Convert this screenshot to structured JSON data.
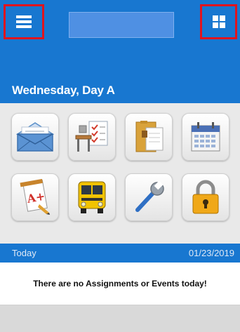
{
  "header": {
    "menu_icon": "hamburger-menu-icon",
    "apps_icon": "grid-apps-icon",
    "day": "Wednesday, Day A"
  },
  "tiles": [
    {
      "name": "mail-tile",
      "icon": "envelope-icon"
    },
    {
      "name": "classroom-tile",
      "icon": "classroom-desk-icon"
    },
    {
      "name": "folder-tile",
      "icon": "folder-documents-icon"
    },
    {
      "name": "calendar-tile",
      "icon": "calendar-icon"
    },
    {
      "name": "grades-tile",
      "icon": "report-card-icon"
    },
    {
      "name": "bus-tile",
      "icon": "school-bus-icon"
    },
    {
      "name": "tools-tile",
      "icon": "wrench-icon"
    },
    {
      "name": "lock-tile",
      "icon": "padlock-icon"
    }
  ],
  "today_bar": {
    "label": "Today",
    "date": "01/23/2019"
  },
  "message": "There are no Assignments or Events today!",
  "colors": {
    "header_blue": "#1877d0",
    "highlight_red": "#e0141e",
    "tile_bg": "#e9e9e9"
  }
}
